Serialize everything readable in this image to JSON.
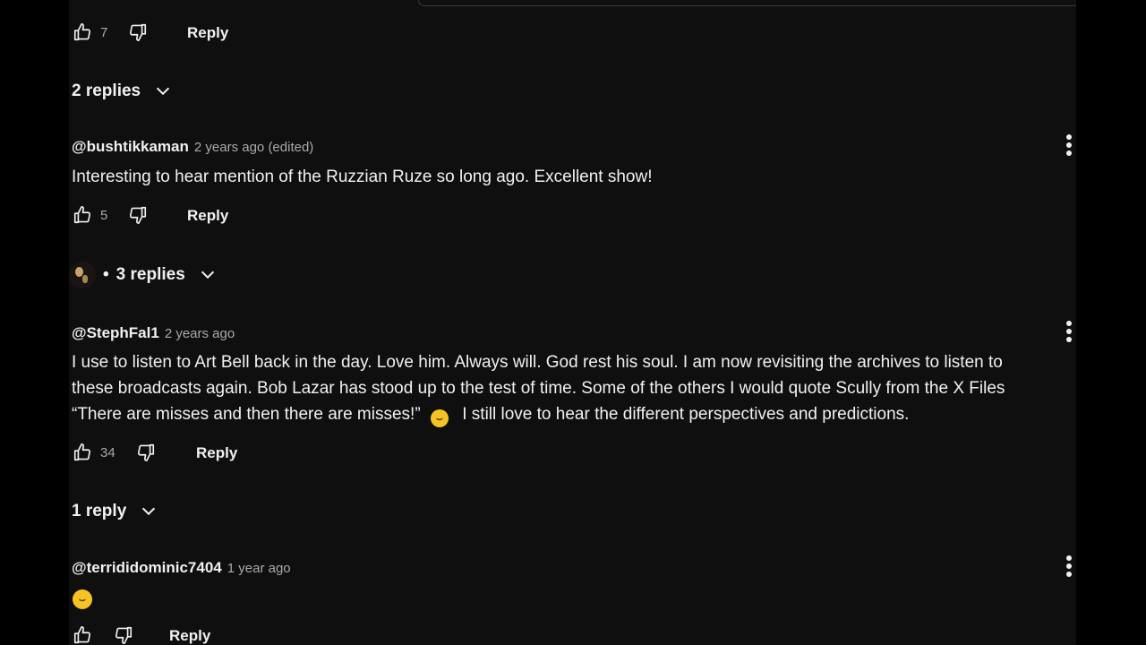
{
  "comments": [
    {
      "likes": "7",
      "reply_label": "Reply",
      "replies_label": "2 replies"
    },
    {
      "handle": "@bushtikkaman",
      "meta": "2 years ago (edited)",
      "text_lines": [
        "Interesting to hear mention of the Ruzzian Ruze so long ago. Excellent show!"
      ],
      "likes": "5",
      "reply_label": "Reply",
      "replies_label": "3 replies",
      "replies_separator": "•"
    },
    {
      "handle": "@StephFal1",
      "meta": "2 years ago",
      "text_lines": [
        "I use to listen to Art Bell back in the day. Love him. Always will. God rest his soul. I am now revisiting the archives to listen to",
        "these broadcasts again. Bob Lazar has stood up to the test of time. Some of the others I would quote Scully from the X Files",
        "“There are misses and then there are misses!”",
        "I still love to hear the different perspectives and predictions."
      ],
      "likes": "34",
      "reply_label": "Reply",
      "replies_label": "1 reply"
    },
    {
      "handle": "@terrididominic7404",
      "meta": "1 year ago",
      "likes": "",
      "reply_label": "Reply"
    }
  ],
  "icons": {
    "like": "thumbs-up-icon",
    "dislike": "thumbs-down-icon",
    "expand": "chevron-down-icon",
    "more": "more-vertical-icon",
    "emoji": "laughing-emoji-icon"
  },
  "colors": {
    "panel_bg": "#0f0f0f",
    "outer_bg": "#000000",
    "text": "#f1f1f1",
    "meta": "#aaaaaa"
  }
}
